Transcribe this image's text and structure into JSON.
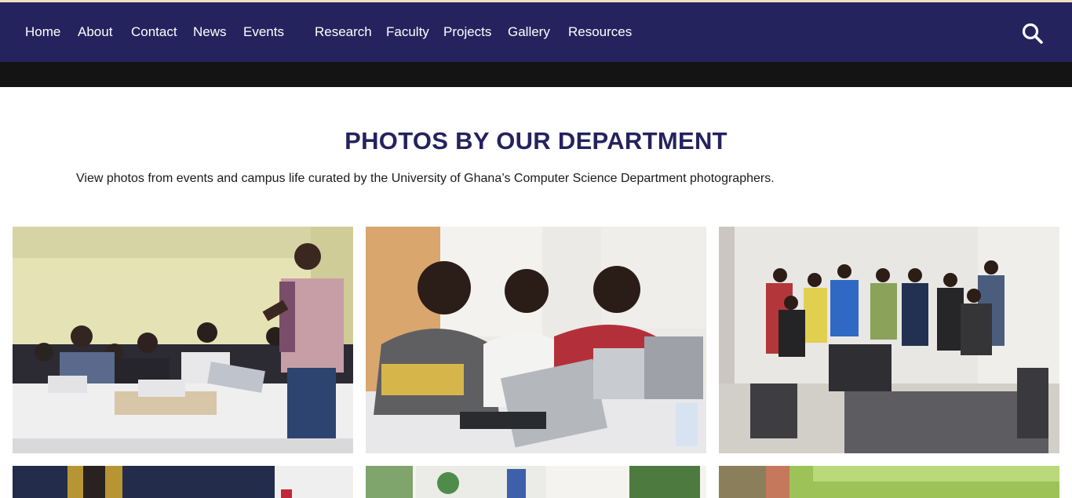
{
  "nav": {
    "items": [
      {
        "label": "Home"
      },
      {
        "label": "About"
      },
      {
        "label": "Contact"
      },
      {
        "label": "News"
      },
      {
        "label": "Events"
      },
      {
        "label": "Research"
      },
      {
        "label": "Faculty"
      },
      {
        "label": "Projects"
      },
      {
        "label": "Gallery"
      },
      {
        "label": "Resources"
      }
    ],
    "search_icon": "search-icon"
  },
  "gallery": {
    "title": "PHOTOS BY OUR DEPARTMENT",
    "description": "View photos from events and campus life curated by the University of Ghana’s Computer Science Department photographers."
  },
  "colors": {
    "nav_bg": "#24235e",
    "title": "#24235e",
    "accent_strip": "#f3dcc1"
  }
}
